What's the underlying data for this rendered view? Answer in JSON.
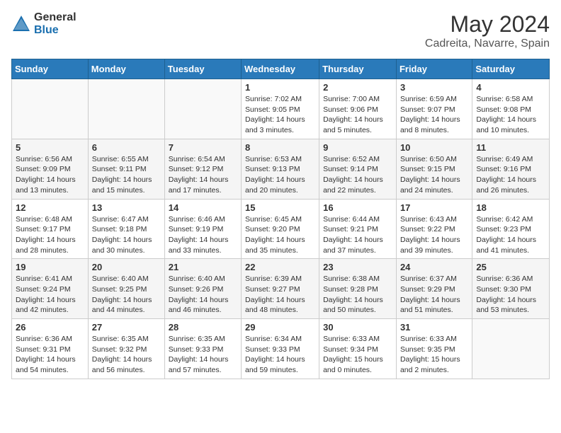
{
  "header": {
    "logo_general": "General",
    "logo_blue": "Blue",
    "month_year": "May 2024",
    "location": "Cadreita, Navarre, Spain"
  },
  "days_of_week": [
    "Sunday",
    "Monday",
    "Tuesday",
    "Wednesday",
    "Thursday",
    "Friday",
    "Saturday"
  ],
  "weeks": [
    [
      {
        "day": "",
        "info": ""
      },
      {
        "day": "",
        "info": ""
      },
      {
        "day": "",
        "info": ""
      },
      {
        "day": "1",
        "info": "Sunrise: 7:02 AM\nSunset: 9:05 PM\nDaylight: 14 hours\nand 3 minutes."
      },
      {
        "day": "2",
        "info": "Sunrise: 7:00 AM\nSunset: 9:06 PM\nDaylight: 14 hours\nand 5 minutes."
      },
      {
        "day": "3",
        "info": "Sunrise: 6:59 AM\nSunset: 9:07 PM\nDaylight: 14 hours\nand 8 minutes."
      },
      {
        "day": "4",
        "info": "Sunrise: 6:58 AM\nSunset: 9:08 PM\nDaylight: 14 hours\nand 10 minutes."
      }
    ],
    [
      {
        "day": "5",
        "info": "Sunrise: 6:56 AM\nSunset: 9:09 PM\nDaylight: 14 hours\nand 13 minutes."
      },
      {
        "day": "6",
        "info": "Sunrise: 6:55 AM\nSunset: 9:11 PM\nDaylight: 14 hours\nand 15 minutes."
      },
      {
        "day": "7",
        "info": "Sunrise: 6:54 AM\nSunset: 9:12 PM\nDaylight: 14 hours\nand 17 minutes."
      },
      {
        "day": "8",
        "info": "Sunrise: 6:53 AM\nSunset: 9:13 PM\nDaylight: 14 hours\nand 20 minutes."
      },
      {
        "day": "9",
        "info": "Sunrise: 6:52 AM\nSunset: 9:14 PM\nDaylight: 14 hours\nand 22 minutes."
      },
      {
        "day": "10",
        "info": "Sunrise: 6:50 AM\nSunset: 9:15 PM\nDaylight: 14 hours\nand 24 minutes."
      },
      {
        "day": "11",
        "info": "Sunrise: 6:49 AM\nSunset: 9:16 PM\nDaylight: 14 hours\nand 26 minutes."
      }
    ],
    [
      {
        "day": "12",
        "info": "Sunrise: 6:48 AM\nSunset: 9:17 PM\nDaylight: 14 hours\nand 28 minutes."
      },
      {
        "day": "13",
        "info": "Sunrise: 6:47 AM\nSunset: 9:18 PM\nDaylight: 14 hours\nand 30 minutes."
      },
      {
        "day": "14",
        "info": "Sunrise: 6:46 AM\nSunset: 9:19 PM\nDaylight: 14 hours\nand 33 minutes."
      },
      {
        "day": "15",
        "info": "Sunrise: 6:45 AM\nSunset: 9:20 PM\nDaylight: 14 hours\nand 35 minutes."
      },
      {
        "day": "16",
        "info": "Sunrise: 6:44 AM\nSunset: 9:21 PM\nDaylight: 14 hours\nand 37 minutes."
      },
      {
        "day": "17",
        "info": "Sunrise: 6:43 AM\nSunset: 9:22 PM\nDaylight: 14 hours\nand 39 minutes."
      },
      {
        "day": "18",
        "info": "Sunrise: 6:42 AM\nSunset: 9:23 PM\nDaylight: 14 hours\nand 41 minutes."
      }
    ],
    [
      {
        "day": "19",
        "info": "Sunrise: 6:41 AM\nSunset: 9:24 PM\nDaylight: 14 hours\nand 42 minutes."
      },
      {
        "day": "20",
        "info": "Sunrise: 6:40 AM\nSunset: 9:25 PM\nDaylight: 14 hours\nand 44 minutes."
      },
      {
        "day": "21",
        "info": "Sunrise: 6:40 AM\nSunset: 9:26 PM\nDaylight: 14 hours\nand 46 minutes."
      },
      {
        "day": "22",
        "info": "Sunrise: 6:39 AM\nSunset: 9:27 PM\nDaylight: 14 hours\nand 48 minutes."
      },
      {
        "day": "23",
        "info": "Sunrise: 6:38 AM\nSunset: 9:28 PM\nDaylight: 14 hours\nand 50 minutes."
      },
      {
        "day": "24",
        "info": "Sunrise: 6:37 AM\nSunset: 9:29 PM\nDaylight: 14 hours\nand 51 minutes."
      },
      {
        "day": "25",
        "info": "Sunrise: 6:36 AM\nSunset: 9:30 PM\nDaylight: 14 hours\nand 53 minutes."
      }
    ],
    [
      {
        "day": "26",
        "info": "Sunrise: 6:36 AM\nSunset: 9:31 PM\nDaylight: 14 hours\nand 54 minutes."
      },
      {
        "day": "27",
        "info": "Sunrise: 6:35 AM\nSunset: 9:32 PM\nDaylight: 14 hours\nand 56 minutes."
      },
      {
        "day": "28",
        "info": "Sunrise: 6:35 AM\nSunset: 9:33 PM\nDaylight: 14 hours\nand 57 minutes."
      },
      {
        "day": "29",
        "info": "Sunrise: 6:34 AM\nSunset: 9:33 PM\nDaylight: 14 hours\nand 59 minutes."
      },
      {
        "day": "30",
        "info": "Sunrise: 6:33 AM\nSunset: 9:34 PM\nDaylight: 15 hours\nand 0 minutes."
      },
      {
        "day": "31",
        "info": "Sunrise: 6:33 AM\nSunset: 9:35 PM\nDaylight: 15 hours\nand 2 minutes."
      },
      {
        "day": "",
        "info": ""
      }
    ]
  ]
}
